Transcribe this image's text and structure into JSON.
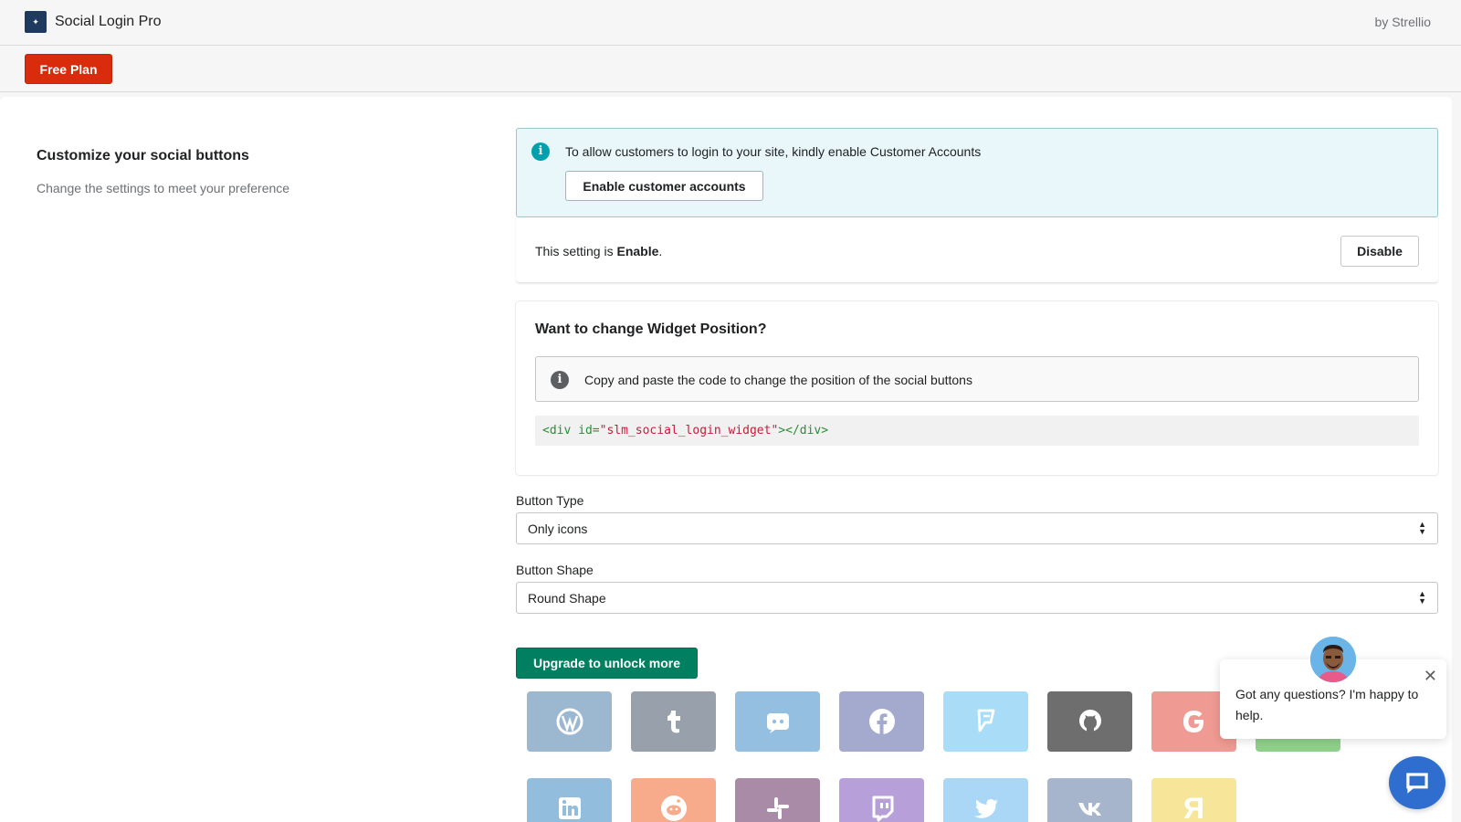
{
  "header": {
    "app_title": "Social Login Pro",
    "by_line": "by Strellio",
    "logo_icon": "app-logo-icon"
  },
  "plan": {
    "label": "Free Plan",
    "color": "#d82c0d"
  },
  "section": {
    "title": "Customize your social buttons",
    "subtitle": "Change the settings to meet your preference"
  },
  "banner": {
    "text": "To allow customers to login to your site, kindly enable Customer Accounts",
    "button_label": "Enable customer accounts",
    "icon": "info-icon"
  },
  "setting": {
    "prefix": "This setting is ",
    "status": "Enable",
    "suffix": ".",
    "button_label": "Disable"
  },
  "widget": {
    "title": "Want to change Widget Position?",
    "note": "Copy and paste the code to change the position of the social buttons",
    "code": {
      "open_tag": "<div id=",
      "attr_value": "\"slm_social_login_widget\"",
      "close_tag": "></div>"
    }
  },
  "button_type": {
    "label": "Button Type",
    "value": "Only icons"
  },
  "button_shape": {
    "label": "Button Shape",
    "value": "Round Shape"
  },
  "upgrade": {
    "label": "Upgrade to unlock more",
    "color": "#008060"
  },
  "social_row_1": [
    {
      "name": "wordpress",
      "icon": "wordpress-icon",
      "color": "#9cb8d0"
    },
    {
      "name": "tumblr",
      "icon": "tumblr-icon",
      "color": "#97a0ab"
    },
    {
      "name": "discord",
      "icon": "discord-icon",
      "color": "#94bfe0"
    },
    {
      "name": "facebook",
      "icon": "facebook-icon",
      "color": "#a4aacd"
    },
    {
      "name": "foursquare",
      "icon": "foursquare-icon",
      "color": "#a9dcf7"
    },
    {
      "name": "github",
      "icon": "github-icon",
      "color": "#6e6e6e"
    },
    {
      "name": "google",
      "icon": "google-icon",
      "color": "#ef9a92"
    },
    {
      "name": "line",
      "icon": "line-icon",
      "color": "#8fd18b"
    }
  ],
  "social_row_2": [
    {
      "name": "linkedin",
      "icon": "linkedin-icon",
      "color": "#93bddd"
    },
    {
      "name": "reddit",
      "icon": "reddit-icon",
      "color": "#f7ab8a"
    },
    {
      "name": "slack",
      "icon": "slack-icon",
      "color": "#a98aa7"
    },
    {
      "name": "twitch",
      "icon": "twitch-icon",
      "color": "#b7a0d9"
    },
    {
      "name": "twitter",
      "icon": "twitter-icon",
      "color": "#a9d7f5"
    },
    {
      "name": "vk",
      "icon": "vk-icon",
      "color": "#a6b5cc"
    },
    {
      "name": "yandex",
      "icon": "yandex-icon",
      "color": "#f7e69a",
      "glyph": "Я"
    }
  ],
  "chat": {
    "message": "Got any questions? I'm happy to help.",
    "close_icon": "close-icon",
    "avatar_icon": "support-agent-avatar",
    "launcher_icon": "chat-bubble-icon",
    "launcher_color": "#2f6ecf"
  }
}
